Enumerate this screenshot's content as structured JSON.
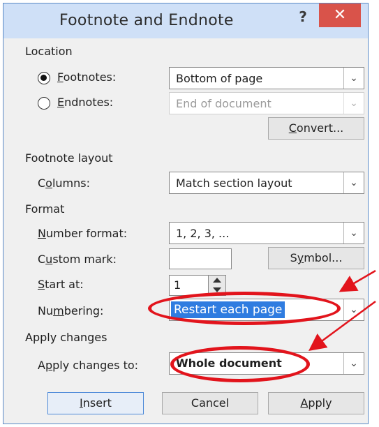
{
  "dialog": {
    "title": "Footnote and Endnote",
    "help_label": "?",
    "close_label": "✕"
  },
  "location": {
    "section_label": "Location",
    "footnotes_label": "Footnotes:",
    "footnotes_checked": true,
    "footnotes_value": "Bottom of page",
    "endnotes_label": "Endnotes:",
    "endnotes_checked": false,
    "endnotes_value": "End of document",
    "convert_label": "Convert..."
  },
  "footnote_layout": {
    "section_label": "Footnote layout",
    "columns_label": "Columns:",
    "columns_value": "Match section layout"
  },
  "format": {
    "section_label": "Format",
    "number_format_label": "Number format:",
    "number_format_value": "1, 2, 3, ...",
    "custom_mark_label": "Custom mark:",
    "custom_mark_value": "",
    "symbol_label": "Symbol...",
    "start_at_label": "Start at:",
    "start_at_value": "1",
    "numbering_label": "Numbering:",
    "numbering_value": "Restart each page"
  },
  "apply_changes": {
    "section_label": "Apply changes",
    "apply_to_label": "Apply changes to:",
    "apply_to_value": "Whole document"
  },
  "buttons": {
    "insert_label": "Insert",
    "cancel_label": "Cancel",
    "apply_label": "Apply"
  },
  "colors": {
    "annotation_red": "#e2141c",
    "selection_blue": "#2f7ce0",
    "titlebar": "#cfe0f7",
    "close_red": "#d9534a"
  }
}
